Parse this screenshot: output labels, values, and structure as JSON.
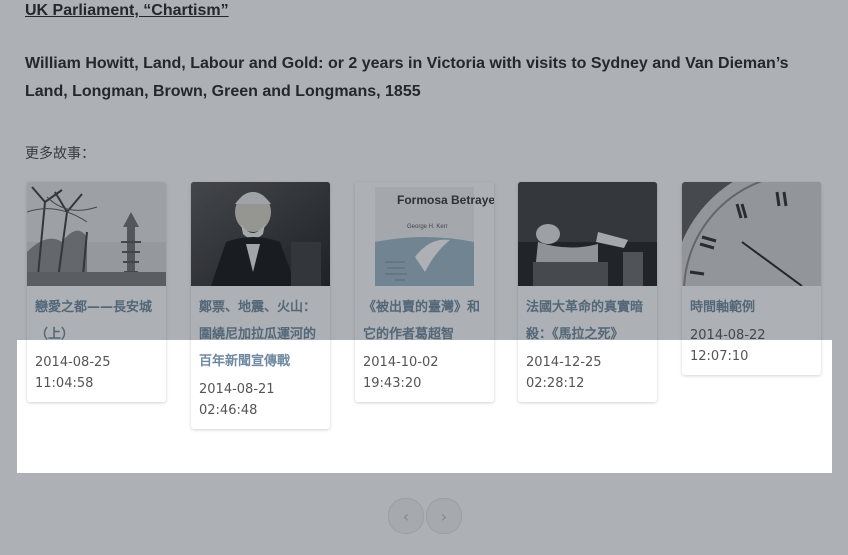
{
  "reference_link": "UK Parliament, “Chartism”",
  "reference_text": "William Howitt, Land, Labour and Gold: or 2 years in Victoria with visits to Sydney and Van Dieman’s Land, Longman, Brown, Green and Longmans, 1855",
  "more_stories_label": "更多故事：",
  "cards": [
    {
      "title": "戀愛之都——長安城（上）",
      "date": "2014-08-25",
      "time": "11:04:58",
      "image": "city-pagoda-photo"
    },
    {
      "title": "鄭票、地震、火山：圍繞尼加拉瓜運河的百年新聞宣傳戰",
      "date": "2014-08-21",
      "time": "02:46:48",
      "image": "portrait-photo"
    },
    {
      "title": "《被出賣的臺灣》和它的作者葛超智",
      "date": "2014-10-02",
      "time": "19:43:20",
      "image": "book-cover-image"
    },
    {
      "title": "法國大革命的真實暗殺：《馬拉之死》",
      "date": "2014-12-25",
      "time": "02:28:12",
      "image": "painting-image"
    },
    {
      "title": "時間軸範例",
      "date": "2014-08-22",
      "time": "12:07:10",
      "image": "clock-photo"
    }
  ],
  "book_cover_text": "Formosa Betrayed",
  "book_cover_author": "George H. Kerr",
  "pager": {
    "prev_icon": "chevron-left-icon",
    "next_icon": "chevron-right-icon"
  }
}
